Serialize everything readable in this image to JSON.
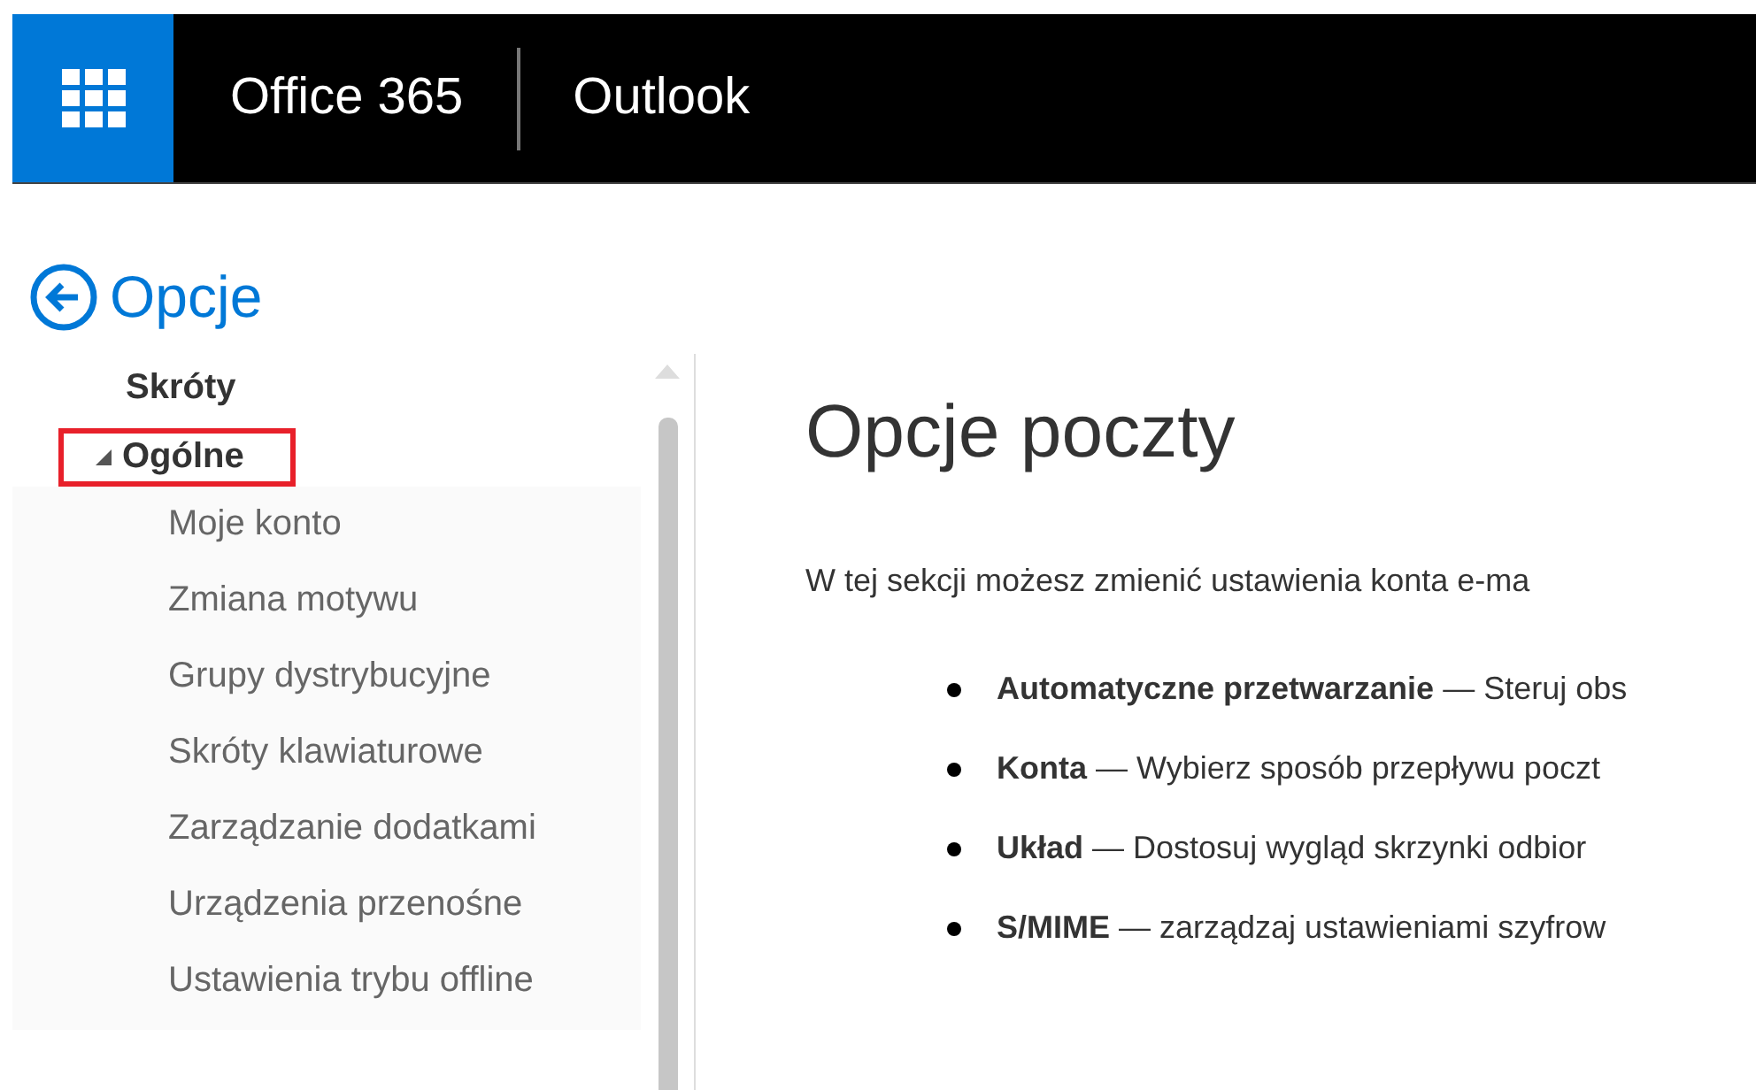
{
  "header": {
    "suite": "Office 365",
    "app": "Outlook"
  },
  "back": {
    "label": "Opcje"
  },
  "sidebar": {
    "items": [
      {
        "label": "Skróty",
        "highlighted": false
      },
      {
        "label": "Ogólne",
        "expanded": true,
        "highlighted": true,
        "children": [
          {
            "label": "Moje konto"
          },
          {
            "label": "Zmiana motywu"
          },
          {
            "label": "Grupy dystrybucyjne"
          },
          {
            "label": "Skróty klawiaturowe"
          },
          {
            "label": "Zarządzanie dodatkami"
          },
          {
            "label": "Urządzenia przenośne"
          },
          {
            "label": "Ustawienia trybu offline"
          }
        ]
      }
    ]
  },
  "main": {
    "title": "Opcje poczty",
    "intro": "W tej sekcji możesz zmienić ustawienia konta e-ma",
    "bullets": [
      "**Automatyczne przetwarzanie** — Steruj obs",
      "**Konta** — Wybierz sposób przepływu poczt",
      "**Układ** — Dostosuj wygląd skrzynki odbior",
      "**S/MIME** — zarządzaj ustawieniami szyfrow"
    ]
  }
}
